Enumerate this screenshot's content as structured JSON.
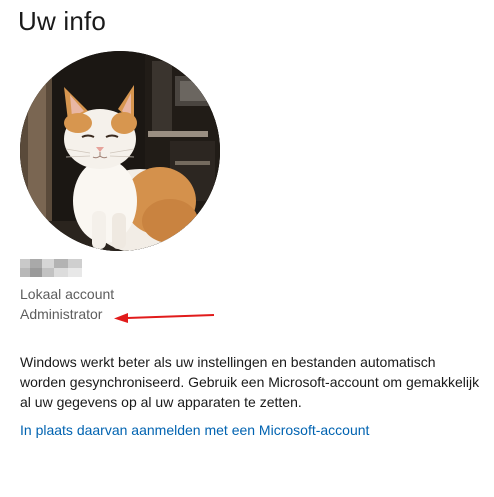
{
  "page": {
    "title": "Uw info"
  },
  "account": {
    "type": "Lokaal account",
    "role": "Administrator"
  },
  "sync": {
    "message": "Windows werkt beter als uw instellingen en bestanden automatisch worden gesynchroniseerd. Gebruik een Microsoft-account om gemakkelijk al uw gegevens op al uw apparaten te zetten.",
    "link_label": "In plaats daarvan aanmelden met een Microsoft-account"
  },
  "colors": {
    "link": "#0063b1",
    "annotation_arrow": "#e11b1b",
    "secondary_text": "#5d5d5d"
  }
}
